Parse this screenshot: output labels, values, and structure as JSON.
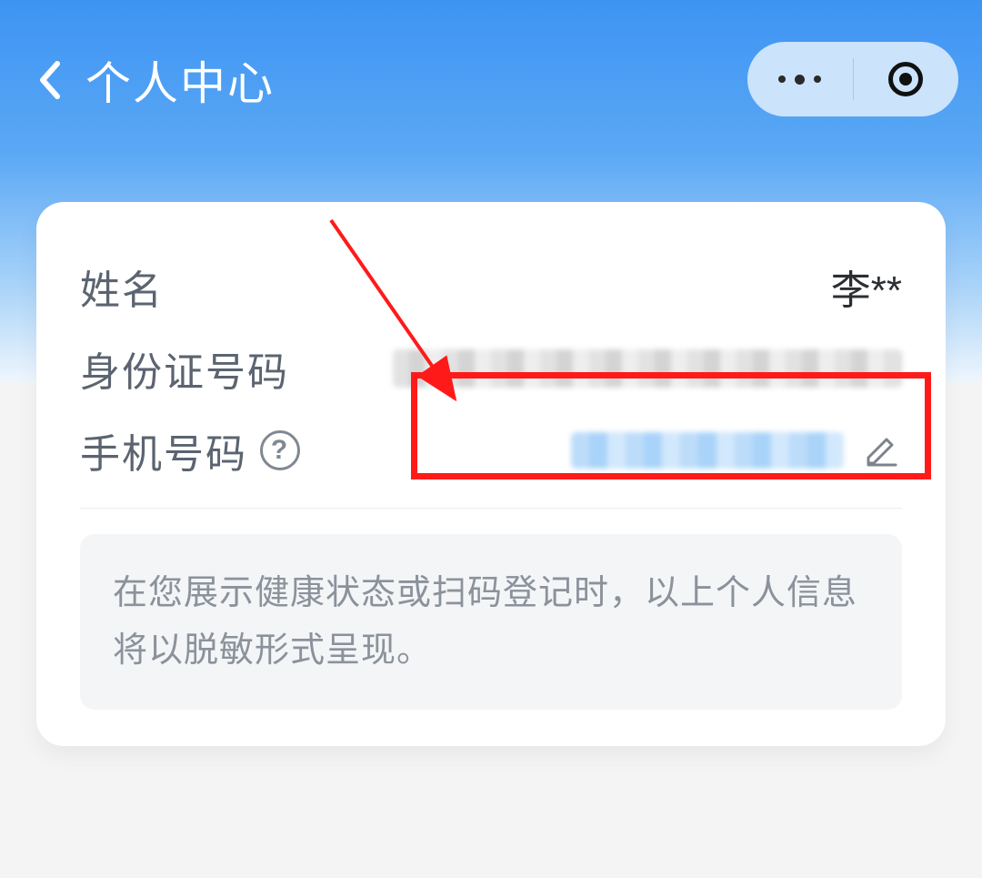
{
  "header": {
    "title": "个人中心"
  },
  "card": {
    "rows": {
      "name": {
        "label": "姓名",
        "value": "李**"
      },
      "id": {
        "label": "身份证号码"
      },
      "phone": {
        "label": "手机号码"
      }
    },
    "notice": "在您展示健康状态或扫码登记时，以上个人信息将以脱敏形式呈现。"
  }
}
